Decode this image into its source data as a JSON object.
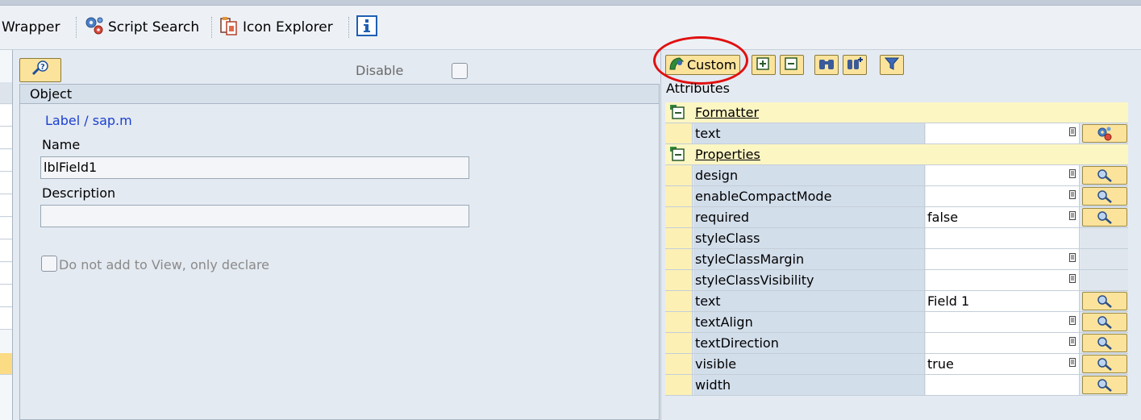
{
  "toolbar": {
    "wrapper_label": "Wrapper",
    "script_search_label": "Script Search",
    "icon_explorer_label": "Icon Explorer"
  },
  "left_panel": {
    "disable_label": "Disable",
    "object_header": "Object",
    "object_link": "Label / sap.m",
    "name_label": "Name",
    "name_value": "lblField1",
    "description_label": "Description",
    "description_value": "",
    "declare_label": "Do not add to View, only declare"
  },
  "right_panel": {
    "custom_label": "Custom",
    "attributes_label": "Attributes",
    "groups": {
      "formatter": "Formatter",
      "properties": "Properties"
    },
    "rows": [
      {
        "name": "text",
        "value": ""
      },
      {
        "name": "design",
        "value": ""
      },
      {
        "name": "enableCompactMode",
        "value": ""
      },
      {
        "name": "required",
        "value": "false"
      },
      {
        "name": "styleClass",
        "value": ""
      },
      {
        "name": "styleClassMargin",
        "value": ""
      },
      {
        "name": "styleClassVisibility",
        "value": ""
      },
      {
        "name": "text",
        "value": "Field 1"
      },
      {
        "name": "textAlign",
        "value": ""
      },
      {
        "name": "textDirection",
        "value": ""
      },
      {
        "name": "visible",
        "value": "true"
      },
      {
        "name": "width",
        "value": ""
      }
    ]
  },
  "colors": {
    "highlight_circle": "#e01010",
    "button_yellow": "#fbe39c",
    "link_blue": "#1a3fd0"
  }
}
